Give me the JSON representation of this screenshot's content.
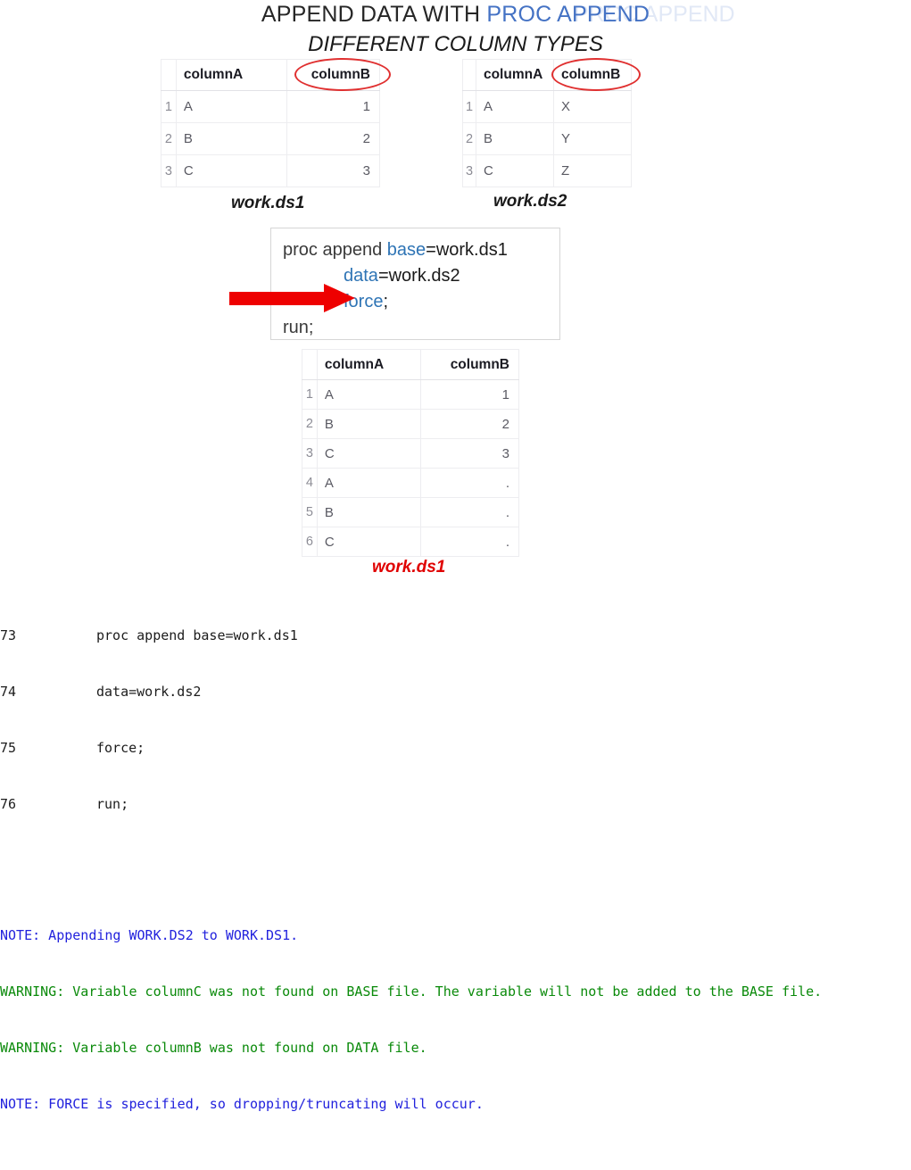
{
  "title": {
    "line1_plain": "APPEND DATA WITH ",
    "line1_accent": "PROC APPEND",
    "line2": "DIFFERENT COLUMN TYPES",
    "ghost": "PROC APPEND",
    "accent_color": "#4472C4"
  },
  "tables": {
    "ds1": {
      "caption": "work.ds1",
      "headers": [
        "",
        "columnA",
        "columnB"
      ],
      "rows": [
        {
          "num": "1",
          "columnA": "A",
          "columnB": "1"
        },
        {
          "num": "2",
          "columnA": "B",
          "columnB": "2"
        },
        {
          "num": "3",
          "columnA": "C",
          "columnB": "3"
        }
      ],
      "highlighted_header": "columnB"
    },
    "ds2": {
      "caption": "work.ds2",
      "headers": [
        "",
        "columnA",
        "columnB"
      ],
      "rows": [
        {
          "num": "1",
          "columnA": "A",
          "columnB": "X"
        },
        {
          "num": "2",
          "columnA": "B",
          "columnB": "Y"
        },
        {
          "num": "3",
          "columnA": "C",
          "columnB": "Z"
        }
      ],
      "highlighted_header": "columnB"
    },
    "result": {
      "caption": "work.ds1",
      "caption_color": "#e00000",
      "headers": [
        "",
        "columnA",
        "columnB"
      ],
      "rows": [
        {
          "num": "1",
          "columnA": "A",
          "columnB": "1"
        },
        {
          "num": "2",
          "columnA": "B",
          "columnB": "2"
        },
        {
          "num": "3",
          "columnA": "C",
          "columnB": "3"
        },
        {
          "num": "4",
          "columnA": "A",
          "columnB": "."
        },
        {
          "num": "5",
          "columnA": "B",
          "columnB": "."
        },
        {
          "num": "6",
          "columnA": "C",
          "columnB": "."
        }
      ]
    }
  },
  "code_box": {
    "line1_proc": "proc append ",
    "line1_kw": "base",
    "line1_val": "=work.ds1",
    "line2_kw": "data",
    "line2_val": "=work.ds2",
    "line3_kw": "force",
    "line3_val": ";",
    "line4": "run;"
  },
  "log": {
    "source_lines": [
      {
        "number": "73",
        "text": "proc append base=work.ds1"
      },
      {
        "number": "74",
        "text": "data=work.ds2"
      },
      {
        "number": "75",
        "text": "force;"
      },
      {
        "number": "76",
        "text": "run;"
      }
    ],
    "messages": [
      {
        "level": "NOTE",
        "text": "NOTE: Appending WORK.DS2 to WORK.DS1.",
        "color": "#2222dd"
      },
      {
        "level": "WARNING",
        "text": "WARNING: Variable columnC was not found on BASE file. The variable will not be added to the BASE file.",
        "color": "#0a8a0a"
      },
      {
        "level": "WARNING",
        "text": "WARNING: Variable columnB was not found on DATA file.",
        "color": "#0a8a0a"
      },
      {
        "level": "NOTE",
        "text": "NOTE: FORCE is specified, so dropping/truncating will occur.",
        "color": "#2222dd"
      }
    ]
  },
  "annotations": {
    "arrow_color": "#ee0000",
    "ellipse_color": "#e03030"
  }
}
